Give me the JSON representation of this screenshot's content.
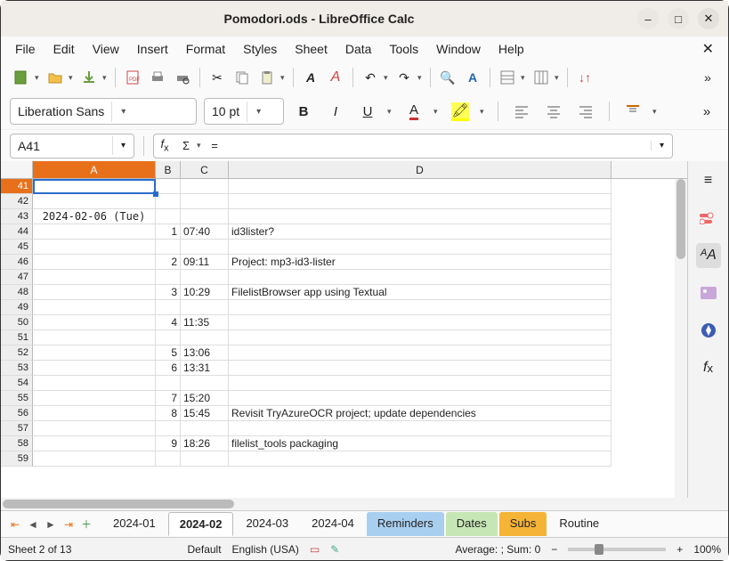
{
  "window": {
    "title": "Pomodori.ods - LibreOffice Calc"
  },
  "menu": [
    "File",
    "Edit",
    "View",
    "Insert",
    "Format",
    "Styles",
    "Sheet",
    "Data",
    "Tools",
    "Window",
    "Help"
  ],
  "font": {
    "name": "Liberation Sans",
    "size": "10 pt"
  },
  "namebox": "A41",
  "colheads": [
    "A",
    "B",
    "C",
    "D"
  ],
  "rows": [
    {
      "n": 41,
      "A": "",
      "B": "",
      "C": "",
      "D": ""
    },
    {
      "n": 42,
      "A": "",
      "B": "",
      "C": "",
      "D": ""
    },
    {
      "n": 43,
      "A": "2024-02-06 (Tue)",
      "B": "",
      "C": "",
      "D": ""
    },
    {
      "n": 44,
      "A": "",
      "B": "1",
      "C": "07:40",
      "D": "id3lister?"
    },
    {
      "n": 45,
      "A": "",
      "B": "",
      "C": "",
      "D": ""
    },
    {
      "n": 46,
      "A": "",
      "B": "2",
      "C": "09:11",
      "D": "Project: mp3-id3-lister"
    },
    {
      "n": 47,
      "A": "",
      "B": "",
      "C": "",
      "D": ""
    },
    {
      "n": 48,
      "A": "",
      "B": "3",
      "C": "10:29",
      "D": "FilelistBrowser app using Textual"
    },
    {
      "n": 49,
      "A": "",
      "B": "",
      "C": "",
      "D": ""
    },
    {
      "n": 50,
      "A": "",
      "B": "4",
      "C": "11:35",
      "D": ""
    },
    {
      "n": 51,
      "A": "",
      "B": "",
      "C": "",
      "D": ""
    },
    {
      "n": 52,
      "A": "",
      "B": "5",
      "C": "13:06",
      "D": ""
    },
    {
      "n": 53,
      "A": "",
      "B": "6",
      "C": "13:31",
      "D": ""
    },
    {
      "n": 54,
      "A": "",
      "B": "",
      "C": "",
      "D": ""
    },
    {
      "n": 55,
      "A": "",
      "B": "7",
      "C": "15:20",
      "D": ""
    },
    {
      "n": 56,
      "A": "",
      "B": "8",
      "C": "15:45",
      "D": "Revisit TryAzureOCR project; update dependencies"
    },
    {
      "n": 57,
      "A": "",
      "B": "",
      "C": "",
      "D": ""
    },
    {
      "n": 58,
      "A": "",
      "B": "9",
      "C": "18:26",
      "D": "filelist_tools packaging"
    },
    {
      "n": 59,
      "A": "",
      "B": "",
      "C": "",
      "D": ""
    }
  ],
  "sheets": [
    {
      "name": "2024-01",
      "cls": ""
    },
    {
      "name": "2024-02",
      "cls": "active"
    },
    {
      "name": "2024-03",
      "cls": ""
    },
    {
      "name": "2024-04",
      "cls": ""
    },
    {
      "name": "Reminders",
      "cls": "reminders"
    },
    {
      "name": "Dates",
      "cls": "dates"
    },
    {
      "name": "Subs",
      "cls": "subs"
    },
    {
      "name": "Routine",
      "cls": ""
    }
  ],
  "status": {
    "sheet": "Sheet 2 of 13",
    "style": "Default",
    "lang": "English (USA)",
    "calc": "Average: ; Sum: 0",
    "zoom": "100%"
  }
}
